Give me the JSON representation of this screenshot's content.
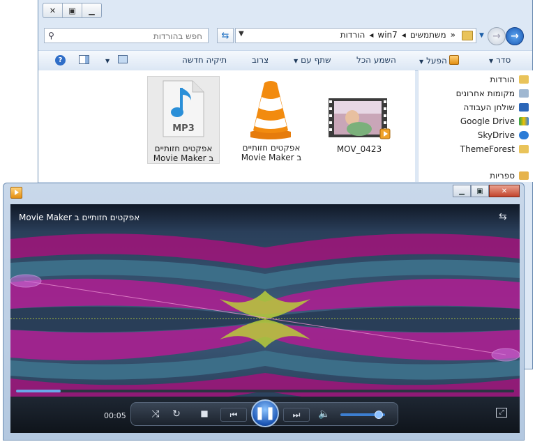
{
  "explorer": {
    "search_placeholder": "חפש בהורדות",
    "breadcrumb": [
      "«",
      "משתמשים",
      "win7",
      "הורדות"
    ],
    "toolbar": {
      "organize": "סדר",
      "play": "הפעל",
      "play_all": "השמע הכל",
      "share_with": "שתף עם",
      "burn": "צרוב",
      "new_folder": "תיקיה חדשה"
    },
    "files": [
      {
        "line1": "אפקטים חזותיים",
        "line2": "Movie Maker ב",
        "type": "mp3",
        "icon_label": "MP3"
      },
      {
        "line1": "אפקטים חזותיים",
        "line2": "Movie Maker ב",
        "type": "vlc"
      },
      {
        "line1": "MOV_0423",
        "line2": "",
        "type": "video"
      }
    ],
    "nav": [
      "הורדות",
      "מקומות אחרונים",
      "שולחן העבודה",
      "Google Drive",
      "SkyDrive",
      "ThemeForest",
      "ספריות"
    ]
  },
  "player": {
    "now_playing": "אפקטים חזותיים ב Movie Maker",
    "time": "00:05",
    "progress": 0.09,
    "volume": 0.85
  },
  "colors": {
    "accent": "#1d57b6",
    "frame": "#c9d8ea",
    "viz_magenta": "#c0168a",
    "viz_teal": "#2f6f8a",
    "viz_yellow": "#c8d83a"
  }
}
